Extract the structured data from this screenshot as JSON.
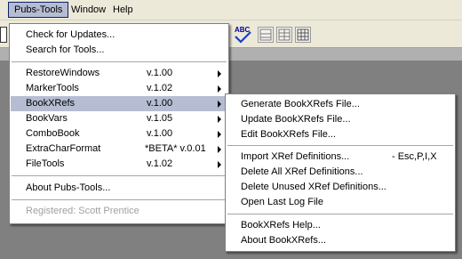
{
  "menubar": {
    "items": [
      {
        "label": "Pubs-Tools",
        "active": true
      },
      {
        "label": "Window",
        "active": false
      },
      {
        "label": "Help",
        "active": false
      }
    ]
  },
  "toolbar": {
    "spellcheck_label": "ABC"
  },
  "pubs_menu": {
    "group1": [
      "Check for Updates...",
      "Search for Tools..."
    ],
    "tools": [
      {
        "label": "RestoreWindows",
        "version": "v.1.00"
      },
      {
        "label": "MarkerTools",
        "version": "v.1.02"
      },
      {
        "label": "BookXRefs",
        "version": "v.1.00"
      },
      {
        "label": "BookVars",
        "version": "v.1.05"
      },
      {
        "label": "ComboBook",
        "version": "v.1.00"
      },
      {
        "label": "ExtraCharFormat",
        "version": "*BETA* v.0.01"
      },
      {
        "label": "FileTools",
        "version": "v.1.02"
      }
    ],
    "about": "About Pubs-Tools...",
    "registered": "Registered: Scott Prentice"
  },
  "bookxrefs_submenu": {
    "group1": [
      "Generate BookXRefs File...",
      "Update BookXRefs File...",
      "Edit BookXRefs File..."
    ],
    "group2": [
      {
        "label": "Import XRef Definitions...",
        "shortcut": "- Esc,P,I,X"
      },
      {
        "label": "Delete All XRef Definitions...",
        "shortcut": ""
      },
      {
        "label": "Delete Unused XRef Definitions...",
        "shortcut": ""
      },
      {
        "label": "Open Last Log File",
        "shortcut": ""
      }
    ],
    "group3": [
      "BookXRefs Help...",
      "About BookXRefs..."
    ]
  }
}
